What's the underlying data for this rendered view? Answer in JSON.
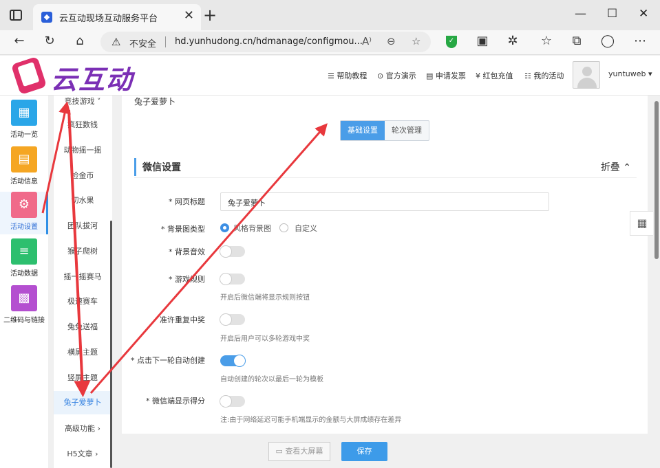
{
  "browser": {
    "tab_title": "云互动现场互动服务平台",
    "insecure_label": "不安全",
    "url": "hd.yunhudong.cn/hdmanage/configmou..."
  },
  "header": {
    "logo_text": "云互动",
    "nav": [
      {
        "icon": "document-icon",
        "label": "帮助教程"
      },
      {
        "icon": "play-icon",
        "label": "官方演示"
      },
      {
        "icon": "invoice-icon",
        "label": "申请发票"
      },
      {
        "icon": "yen-icon",
        "label": "红包充值"
      },
      {
        "icon": "list-icon",
        "label": "我的活动"
      }
    ],
    "username": "yuntuweb"
  },
  "rail": [
    {
      "label": "活动一览",
      "icon": "grid-icon",
      "color": "#2aa6e8"
    },
    {
      "label": "活动信息",
      "icon": "doc-icon",
      "color": "#f5a623"
    },
    {
      "label": "活动设置",
      "icon": "gear-icon",
      "color": "#f06a8a"
    },
    {
      "label": "活动数据",
      "icon": "database-icon",
      "color": "#2dbf6e"
    },
    {
      "label": "二维码与链接",
      "icon": "qrcode-icon",
      "color": "#b44fd0"
    }
  ],
  "submenu": {
    "items": [
      "竞技游戏",
      "疯狂数钱",
      "动物摇一摇",
      "捡金币",
      "切水果",
      "团队拔河",
      "猴子爬树",
      "摇一摇赛马",
      "极速赛车",
      "兔兔送福",
      "横屏主题",
      "竖屏主题",
      "兔子爱萝卜",
      "高级功能",
      "H5文章"
    ]
  },
  "content": {
    "breadcrumb": "兔子爱萝卜",
    "tabs": [
      "基础设置",
      "轮次管理"
    ],
    "section_title": "微信设置",
    "collapse_label": "折叠 ⌃",
    "fields": {
      "page_title_label": "* 网页标题",
      "page_title_value": "兔子爱萝卜",
      "bg_type_label": "* 背景图类型",
      "bg_type_options": [
        "风格背景图",
        "自定义"
      ],
      "bg_music_label": "* 背景音效",
      "game_rules_label": "* 游戏规则",
      "game_rules_hint": "开启后微信端将显示规则按钮",
      "repeat_win_label": "准许重复中奖",
      "repeat_win_hint": "开启后用户可以多轮游戏中奖",
      "auto_next_label": "* 点击下一轮自动创建",
      "auto_next_hint": "自动创建的轮次以最后一轮为模板",
      "show_score_label": "* 微信端显示得分",
      "show_score_hint": "注:由于网络延迟可能手机端显示的金额与大屏成绩存在差异"
    }
  },
  "footer": {
    "preview_label": "查看大屏幕",
    "save_label": "保存"
  }
}
